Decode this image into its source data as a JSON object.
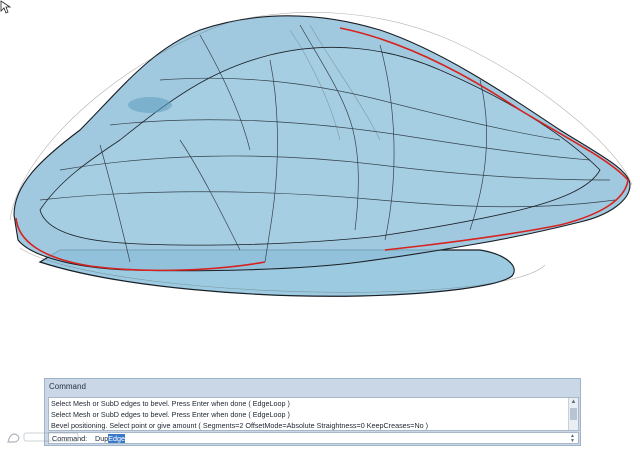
{
  "viewport": {
    "background": "#ffffff",
    "model_fill": "#8fc0d9",
    "edge_color": "#1a1f26",
    "highlight_color": "#d6231f"
  },
  "command_panel": {
    "title": "Command",
    "history": [
      "Select Mesh or SubD edges to bevel. Press Enter when done ( EdgeLoop )",
      "Select Mesh or SubD edges to bevel. Press Enter when done ( EdgeLoop )",
      "Bevel positioning. Select point or give amount ( Segments=2  OffsetMode=Absolute  Straightness=0  KeepCreases=No )"
    ],
    "prompt": "Command:",
    "input_prefix": "Dup",
    "input_selected": "Edge"
  }
}
